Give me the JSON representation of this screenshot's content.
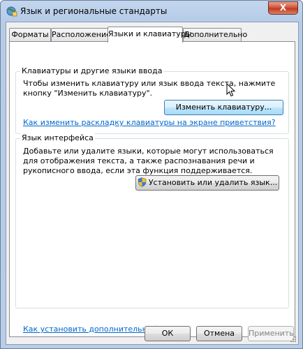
{
  "window": {
    "title": "Язык и региональные стандарты",
    "close_label": "X"
  },
  "tabs": [
    {
      "label": "Форматы"
    },
    {
      "label": "Расположение"
    },
    {
      "label": "Языки и клавиатуры"
    },
    {
      "label": "Дополнительно"
    }
  ],
  "keyboards": {
    "title": "Клавиатуры и другие языки ввода",
    "text": "Чтобы изменить клавиатуру или язык ввода текста, нажмите кнопку \"Изменить клавиатуру\".",
    "button_label": "Изменить клавиатуру...",
    "link": "Как изменить раскладку клавиатуры на экране приветствия?"
  },
  "display_language": {
    "title": "Язык интерфейса",
    "text": "Добавьте или удалите языки, которые могут использоваться для отображения текста, а также распознавания речи и рукописного ввода, если эта функция поддерживается.",
    "button_label": "Установить или удалить язык..."
  },
  "footer": {
    "link": "Как установить дополнительный язык?",
    "ok": "ОК",
    "cancel": "Отмена",
    "apply": "Применить"
  }
}
